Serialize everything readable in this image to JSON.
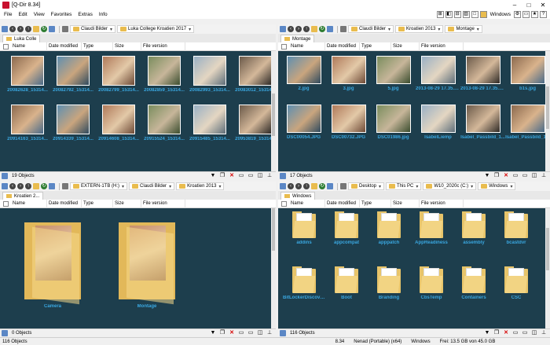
{
  "app": {
    "title": "[Q-Dir 8.34]"
  },
  "window_buttons": [
    "–",
    "□",
    "✕"
  ],
  "menu": [
    "File",
    "Edit",
    "View",
    "Favorites",
    "Extras",
    "Info"
  ],
  "menu_right": {
    "windows_label": "Windows"
  },
  "columns": [
    "Name",
    "Date modified",
    "Type",
    "Size",
    "File version"
  ],
  "panes": [
    {
      "id": "tl",
      "breadcrumbs": [
        "Claudi Bilder",
        "Luka College Kroatien 2017"
      ],
      "tab": "Luka Colle",
      "status": "19 Objects",
      "thumb_pct": 55,
      "items": [
        {
          "label": "20082628_15314..."
        },
        {
          "label": "20082792_15314..."
        },
        {
          "label": "20082799_15314..."
        },
        {
          "label": "20082859_15314..."
        },
        {
          "label": "20082993_15314..."
        },
        {
          "label": "20083012_15314..."
        },
        {
          "label": "20914163_15314..."
        },
        {
          "label": "20914339_15314..."
        },
        {
          "label": "20914608_15314..."
        },
        {
          "label": "20915524_15314..."
        },
        {
          "label": "20915485_15314..."
        },
        {
          "label": "20953819_15314..."
        }
      ]
    },
    {
      "id": "tr",
      "breadcrumbs": [
        "Claudi Bilder",
        "Kroatien 2013",
        "Montage"
      ],
      "tab": "Montage",
      "status": "17 Objects",
      "thumb_pct": 45,
      "items": [
        {
          "label": "2.jpg"
        },
        {
          "label": "3.jpg"
        },
        {
          "label": "5.jpg"
        },
        {
          "label": "2013-08-29 17.35.23.jpg"
        },
        {
          "label": "2013-08-29 17.35.49.jpg"
        },
        {
          "label": "b1s.jpg"
        },
        {
          "label": "DSC00054.JPG"
        },
        {
          "label": "DSC00732.JPG"
        },
        {
          "label": "DSC01986.jpg"
        },
        {
          "label": "IsabelLiemp"
        },
        {
          "label": "Isabel_Passbild_1..."
        },
        {
          "label": "Isabel_Passbild_1..."
        }
      ]
    },
    {
      "id": "bl",
      "breadcrumbs": [
        "EXTERN-1TB (H:)",
        "Claudi Bilder",
        "Kroatien 2013"
      ],
      "tab": "Kroatien 2...",
      "status": "0 Objects",
      "thumb_pct": 0,
      "items": [
        {
          "label": "Camera"
        },
        {
          "label": "Montage"
        }
      ]
    },
    {
      "id": "br",
      "breadcrumbs": [
        "Desktop",
        "This PC",
        "W10_2020c (C:)",
        "Windows"
      ],
      "tab": "Windows",
      "status": "116 Objects",
      "thumb_pct": 25,
      "items": [
        {
          "label": "addins"
        },
        {
          "label": "appcompat"
        },
        {
          "label": "apppatch"
        },
        {
          "label": "AppReadiness"
        },
        {
          "label": "assembly"
        },
        {
          "label": "bcastdvr"
        },
        {
          "label": "BitLockerDiscove..."
        },
        {
          "label": "Boot"
        },
        {
          "label": "Branding"
        },
        {
          "label": "CbsTemp"
        },
        {
          "label": "Containers"
        },
        {
          "label": "CSC"
        }
      ]
    }
  ],
  "bottom": {
    "objects": "116 Objects",
    "version": "8.34",
    "portable": "Nenad (Portable) (x64)",
    "path": "Windows",
    "free": "Frei: 13.5 GB von 45.0 GB"
  },
  "colors": {
    "content_bg": "#1d3e4d",
    "label": "#3aa7e0",
    "folder": "#e7c46a"
  }
}
